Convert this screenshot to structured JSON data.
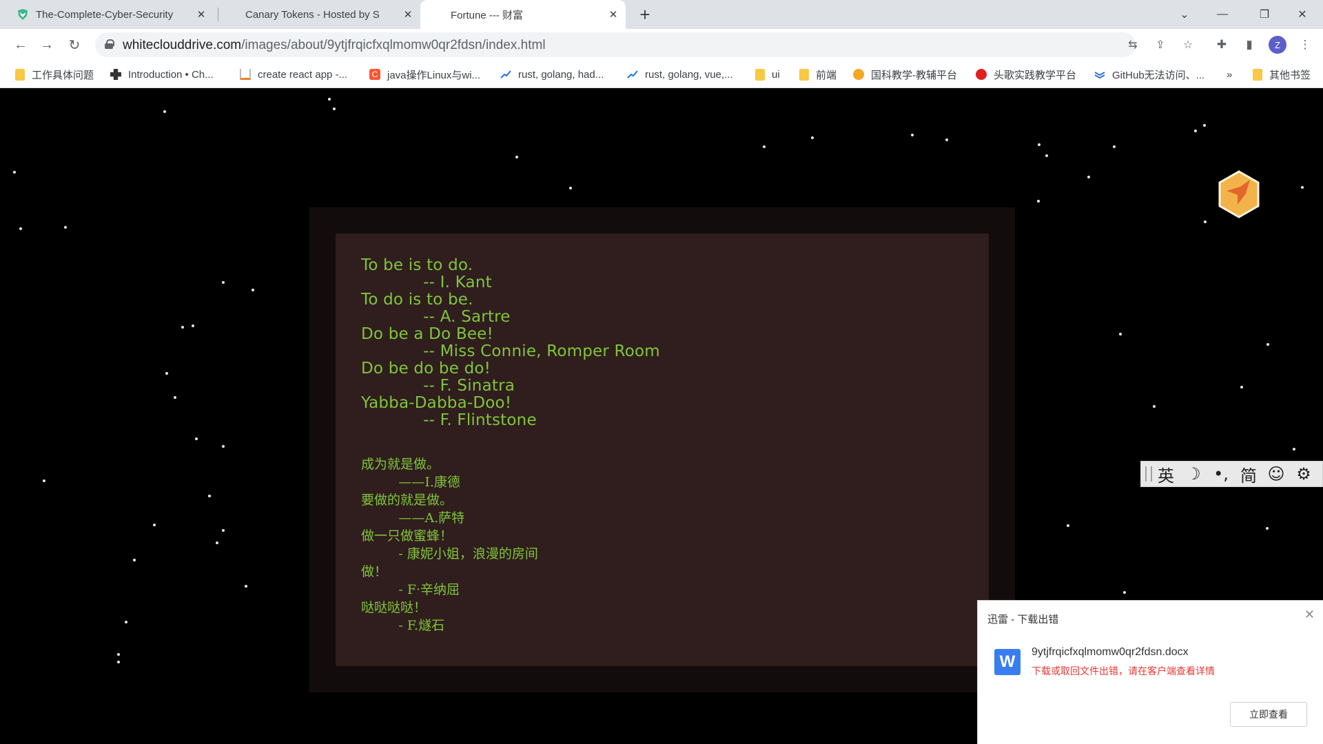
{
  "tabs": [
    {
      "title": "The-Complete-Cyber-Security",
      "icon": "fox-shield-icon"
    },
    {
      "title": "Canary Tokens - Hosted by Sta",
      "icon": "canary-icon"
    },
    {
      "title": "Fortune --- 财富",
      "icon": "blank-icon"
    }
  ],
  "address_bar": {
    "host": "whiteclouddrive.com",
    "path": "/images/about/9ytjfrqicfxqlmomw0qr2fdsn/index.html"
  },
  "profile_initial": "Z",
  "bookmarks": [
    {
      "label": "工作具体问题",
      "icon": "folder-icon"
    },
    {
      "label": "Introduction • Ch...",
      "icon": "puzzle-icon"
    },
    {
      "label": "create react app -...",
      "icon": "stack-icon"
    },
    {
      "label": "java操作Linux与wi...",
      "icon": "c-logo-icon"
    },
    {
      "label": "rust, golang, had...",
      "icon": "trend-icon"
    },
    {
      "label": "rust, golang, vue,...",
      "icon": "trend-icon"
    },
    {
      "label": "ui",
      "icon": "folder-icon"
    },
    {
      "label": "前端",
      "icon": "folder-icon"
    },
    {
      "label": "国科教学-教辅平台",
      "icon": "school-icon"
    },
    {
      "label": "头歌实践教学平台",
      "icon": "toutiao-icon"
    },
    {
      "label": "GitHub无法访问、...",
      "icon": "layers-icon"
    },
    {
      "label": "»",
      "icon": ""
    },
    {
      "label": "其他书签",
      "icon": "folder-icon"
    }
  ],
  "fortune": {
    "english": "To be is to do.\n            -- I. Kant\nTo do is to be.\n            -- A. Sartre\nDo be a Do Bee!\n            -- Miss Connie, Romper Room\nDo be do be do!\n            -- F. Sinatra\nYabba-Dabba-Doo!\n            -- F. Flintstone",
    "chinese": "成为就是做。\n         ——I.康德\n要做的就是做。\n         ——A.萨特\n做一只做蜜蜂！\n         - 康妮小姐，浪漫的房间\n做！\n         - F·辛纳屈\n哒哒哒哒！\n         - F.燧石"
  },
  "ime_toolbar": {
    "lang": "英",
    "moon": "☽",
    "punct": "•,",
    "script": "简",
    "emoji": "☺",
    "settings": "⚙"
  },
  "download_popup": {
    "title": "迅雷 - 下载出错",
    "filename": "9ytjfrqicfxqlmomw0qr2fdsn.docx",
    "error": "下载或取回文件出错，请在客户端查看详情",
    "button": "立即查看",
    "file_icon_letter": "W"
  },
  "colors": {
    "fortune_text": "#7ec63b",
    "card_bg": "#301d1d",
    "error_text": "#e53935"
  }
}
